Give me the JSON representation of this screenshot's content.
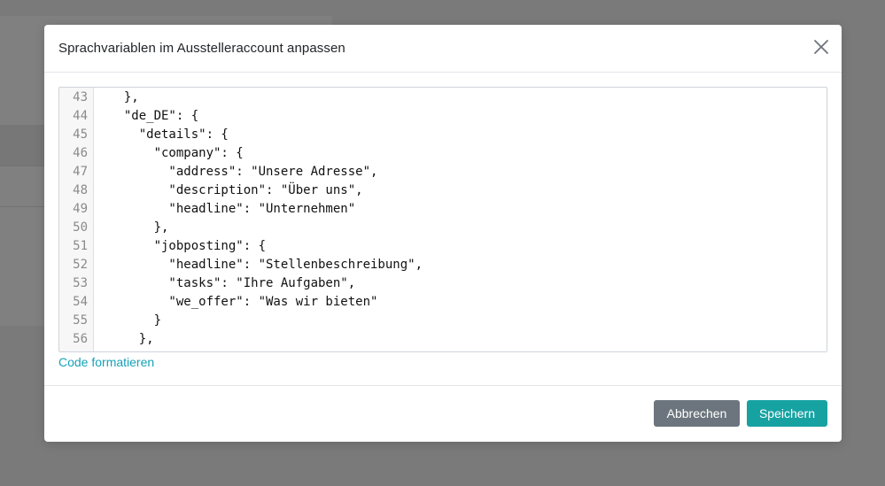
{
  "modal": {
    "title": "Sprachvariablen im Ausstelleraccount anpassen",
    "close_icon": "close-icon",
    "format_link": "Code formatieren",
    "cancel_label": "Abbrechen",
    "save_label": "Speichern"
  },
  "editor": {
    "lines": [
      {
        "num": "43",
        "text": "  },"
      },
      {
        "num": "44",
        "text": "  \"de_DE\": {"
      },
      {
        "num": "45",
        "text": "    \"details\": {"
      },
      {
        "num": "46",
        "text": "      \"company\": {"
      },
      {
        "num": "47",
        "text": "        \"address\": \"Unsere Adresse\","
      },
      {
        "num": "48",
        "text": "        \"description\": \"Über uns\","
      },
      {
        "num": "49",
        "text": "        \"headline\": \"Unternehmen\""
      },
      {
        "num": "50",
        "text": "      },"
      },
      {
        "num": "51",
        "text": "      \"jobposting\": {"
      },
      {
        "num": "52",
        "text": "        \"headline\": \"Stellenbeschreibung\","
      },
      {
        "num": "53",
        "text": "        \"tasks\": \"Ihre Aufgaben\","
      },
      {
        "num": "54",
        "text": "        \"we_offer\": \"Was wir bieten\""
      },
      {
        "num": "55",
        "text": "      }"
      },
      {
        "num": "56",
        "text": "    },"
      }
    ]
  },
  "colors": {
    "accent": "#17a2a2",
    "link": "#17a2b8",
    "cancel": "#6c757d",
    "overlay": "#7a7a7a"
  }
}
